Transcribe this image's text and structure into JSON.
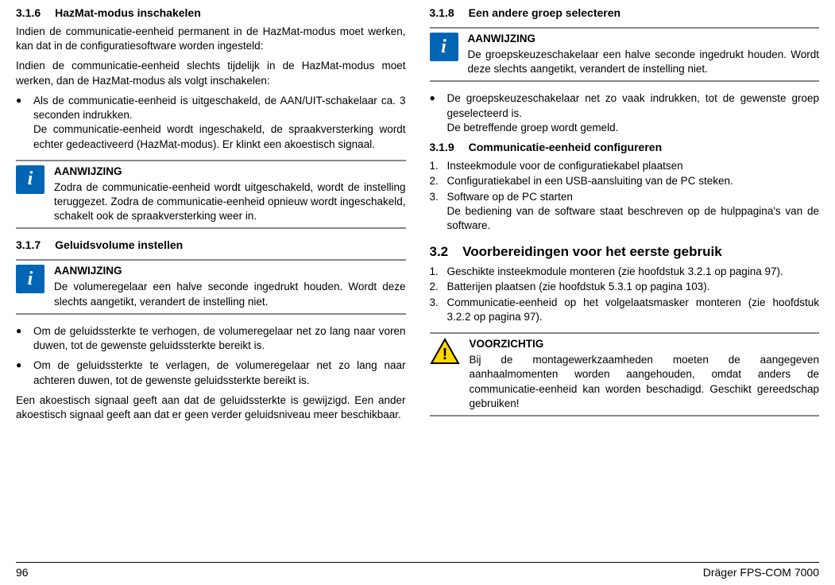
{
  "col1": {
    "s316": {
      "num": "3.1.6",
      "title": "HazMat-modus inschakelen",
      "p1": "Indien de communicatie-eenheid permanent in de HazMat-modus moet werken, kan dat in de configuratiesoftware worden ingesteld:",
      "p2": "Indien de communicatie-eenheid slechts tijdelijk in de HazMat-modus moet werken, dan de HazMat-modus als volgt inschakelen:",
      "bullet1a": "Als de communicatie-eenheid is uitgeschakeld, de AAN/UIT-schakelaar ca. 3 seconden indrukken.",
      "bullet1b": "De communicatie-eenheid wordt ingeschakeld, de spraakversterking wordt echter gedeactiveerd (HazMat-modus). Er klinkt een akoestisch signaal."
    },
    "note1": {
      "label": "AANWIJZING",
      "text": "Zodra de communicatie-eenheid wordt uitgeschakeld, wordt de instelling teruggezet. Zodra de communicatie-eenheid opnieuw wordt ingeschakeld, schakelt ook de spraakversterking weer in."
    },
    "s317": {
      "num": "3.1.7",
      "title": "Geluidsvolume instellen"
    },
    "note2": {
      "label": "AANWIJZING",
      "text": "De volumeregelaar een halve seconde ingedrukt houden. Wordt deze slechts aangetikt, verandert de instelling niet."
    },
    "bullets317": {
      "b1": "Om de geluidssterkte te verhogen, de volumeregelaar net zo lang naar voren duwen, tot de gewenste geluidssterkte bereikt is.",
      "b2": "Om de geluidssterkte te verlagen, de volumeregelaar net zo lang naar achteren duwen, tot de gewenste geluidssterkte bereikt is."
    },
    "p317": "Een akoestisch signaal geeft aan dat de geluidssterkte is gewijzigd. Een ander akoestisch signaal geeft aan dat er geen verder geluidsniveau meer beschikbaar."
  },
  "col2": {
    "s318": {
      "num": "3.1.8",
      "title": "Een andere groep selecteren"
    },
    "note3": {
      "label": "AANWIJZING",
      "text": "De groepskeuzeschakelaar een halve seconde ingedrukt houden. Wordt deze slechts aangetikt, verandert de instelling niet."
    },
    "bullets318": {
      "b1a": "De groepskeuzeschakelaar net zo vaak indrukken, tot de gewenste groep geselecteerd is.",
      "b1b": "De betreffende groep wordt gemeld."
    },
    "s319": {
      "num": "3.1.9",
      "title": "Communicatie-eenheid configureren",
      "i1": "Insteekmodule voor de configuratiekabel plaatsen",
      "i2": "Configuratiekabel in een USB-aansluiting van de PC steken.",
      "i3a": "Software op de PC starten",
      "i3b": "De bediening van de software staat beschreven op de hulppagina's van de software."
    },
    "s32": {
      "num": "3.2",
      "title": "Voorbereidingen voor het eerste gebruik",
      "i1": "Geschikte insteekmodule monteren (zie hoofdstuk 3.2.1 op pagina 97).",
      "i2": "Batterijen plaatsen (zie hoofdstuk 5.3.1 op pagina 103).",
      "i3": "Communicatie-eenheid op het volgelaatsmasker monteren (zie hoofdstuk 3.2.2 op pagina 97)."
    },
    "caution": {
      "label": "VOORZICHTIG",
      "text": "Bij de montagewerkzaamheden moeten de aangegeven aanhaalmomenten worden aangehouden, omdat anders de communicatie-eenheid kan worden beschadigd. Geschikt gereedschap gebruiken!"
    }
  },
  "footer": {
    "page": "96",
    "product": "Dräger FPS-COM 7000"
  }
}
